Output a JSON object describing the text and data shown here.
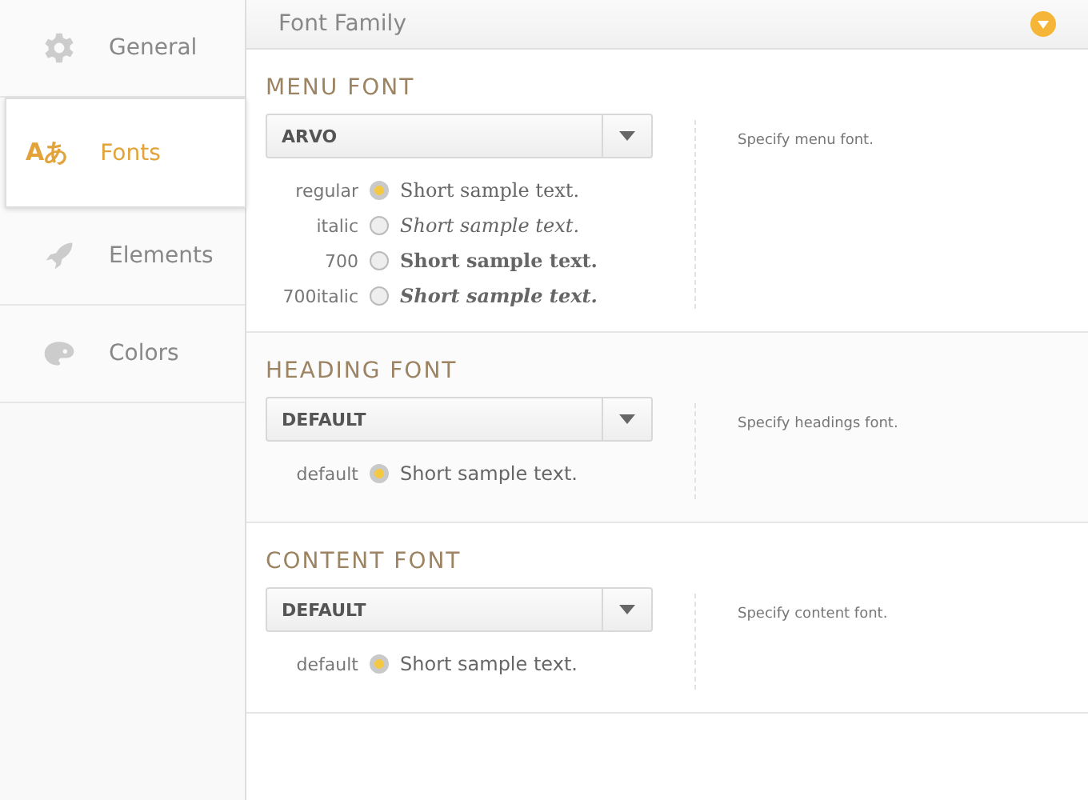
{
  "sidebar": {
    "items": [
      {
        "label": "General",
        "selected": false
      },
      {
        "label": "Fonts",
        "glyph": "Aあ",
        "selected": true
      },
      {
        "label": "Elements",
        "selected": false
      },
      {
        "label": "Colors",
        "selected": false
      }
    ]
  },
  "panel": {
    "title": "Font Family",
    "collapsed": false
  },
  "sections": [
    {
      "title": "MENU FONT",
      "select": {
        "value": "ARVO"
      },
      "description": "Specify menu font.",
      "options": [
        {
          "label": "regular",
          "sample": "Short sample text.",
          "kind": "regular",
          "selected": true
        },
        {
          "label": "italic",
          "sample": "Short sample text.",
          "kind": "italic",
          "selected": false
        },
        {
          "label": "700",
          "sample": "Short sample text.",
          "kind": "bold",
          "selected": false
        },
        {
          "label": "700italic",
          "sample": "Short sample text.",
          "kind": "bold-italic",
          "selected": false
        }
      ]
    },
    {
      "title": "HEADING FONT",
      "select": {
        "value": "DEFAULT"
      },
      "description": "Specify headings font.",
      "options": [
        {
          "label": "default",
          "sample": "Short sample text.",
          "kind": "plain",
          "selected": true
        }
      ]
    },
    {
      "title": "CONTENT FONT",
      "select": {
        "value": "DEFAULT"
      },
      "description": "Specify content font.",
      "options": [
        {
          "label": "default",
          "sample": "Short sample text.",
          "kind": "plain",
          "selected": true
        }
      ]
    }
  ]
}
